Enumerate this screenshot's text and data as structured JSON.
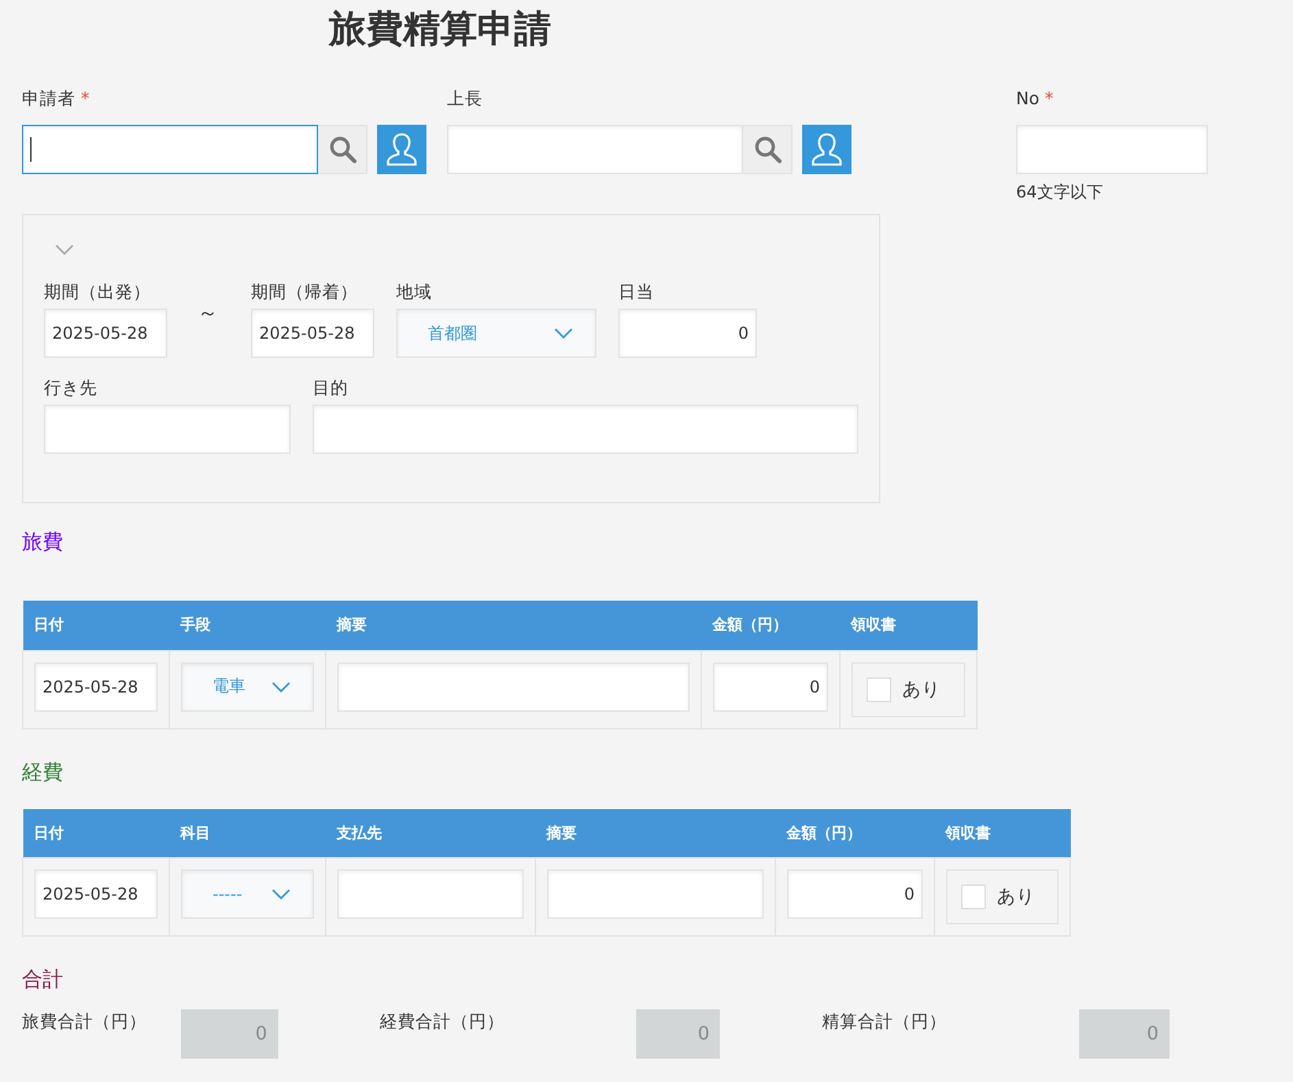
{
  "title": "旅費精算申請",
  "header_fields": [
    {
      "kind": "user",
      "label": "申請者",
      "required_mark": "*",
      "focused": true
    },
    {
      "kind": "user",
      "label": "上長",
      "focused": false
    },
    {
      "kind": "text",
      "label": "No",
      "required_mark": "*",
      "focused": false,
      "hint": "64文字以下"
    }
  ],
  "trip": {
    "fields": [
      {
        "kind": "date",
        "label": "期間（出発）",
        "value": "2025-05-28"
      },
      {
        "kind": "separator",
        "text": "～"
      },
      {
        "kind": "date",
        "label": "期間（帰着）",
        "value": "2025-05-28"
      },
      {
        "kind": "select",
        "label": "地域",
        "value": "首都圏"
      },
      {
        "kind": "number",
        "label": "日当",
        "value": "0"
      },
      {
        "kind": "text",
        "label": "行き先"
      },
      {
        "kind": "wide",
        "label": "目的"
      }
    ]
  },
  "sections": [
    {
      "kind": "table",
      "title": "旅費",
      "color": "#6a00ff",
      "columns": [
        "日付",
        "手段",
        "摘要",
        "金額（円）",
        "領収書"
      ],
      "rows": [
        {
          "cells": [
            {
              "kind": "date",
              "value": "2025-05-28"
            },
            {
              "kind": "select",
              "value": "電車"
            },
            {
              "kind": "text"
            },
            {
              "kind": "number",
              "value": "0"
            },
            {
              "kind": "checkbox",
              "label": "あり",
              "checked": false
            }
          ]
        }
      ]
    },
    {
      "kind": "table",
      "title": "経費",
      "color": "#2e7d32",
      "columns": [
        "日付",
        "科目",
        "支払先",
        "摘要",
        "金額（円）",
        "領収書"
      ],
      "rows": [
        {
          "cells": [
            {
              "kind": "date",
              "value": "2025-05-28"
            },
            {
              "kind": "select",
              "value": "-----"
            },
            {
              "kind": "text"
            },
            {
              "kind": "text"
            },
            {
              "kind": "number",
              "value": "0"
            },
            {
              "kind": "checkbox",
              "label": "あり",
              "checked": false
            }
          ]
        }
      ]
    },
    {
      "kind": "totals",
      "title": "合計",
      "color": "#8b1a4a",
      "items": [
        {
          "label": "旅費合計（円）",
          "value": "0"
        },
        {
          "label": "経費合計（円）",
          "value": "0"
        },
        {
          "label": "精算合計（円）",
          "value": "0"
        }
      ]
    }
  ]
}
